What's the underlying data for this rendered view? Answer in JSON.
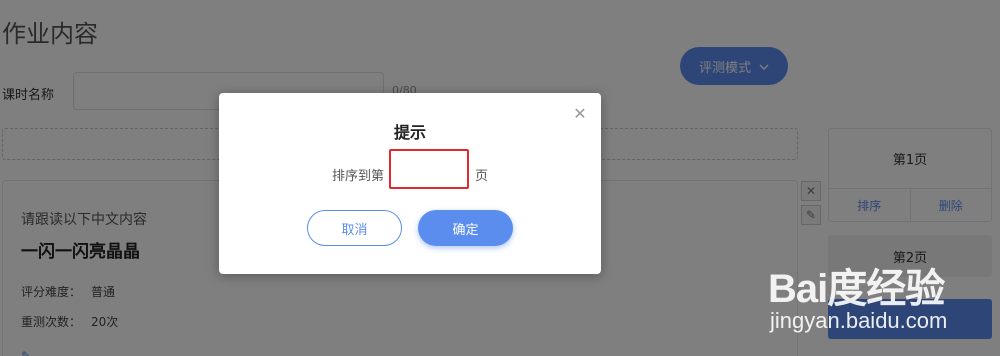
{
  "page": {
    "title": "作业内容",
    "mode_button": "评测模式",
    "lesson_label": "课时名称",
    "lesson_counter": "0/80",
    "card": {
      "prompt": "请跟读以下中文内容",
      "heading": "一闪一闪亮晶晶",
      "difficulty_label": "评分难度：",
      "difficulty_value": "普通",
      "retry_label": "重测次数：",
      "retry_value": "20次"
    },
    "pages": [
      {
        "title": "第1页",
        "sort": "排序",
        "delete": "删除"
      },
      {
        "title": "第2页"
      }
    ]
  },
  "dialog": {
    "title": "提示",
    "sort_prefix": "排序到第",
    "sort_suffix": "页",
    "sort_value": "",
    "cancel": "取消",
    "confirm": "确定",
    "close_icon": "close-icon"
  },
  "watermark": {
    "logo": "Bai度经验",
    "url": "jingyan.baidu.com"
  },
  "colors": {
    "accent": "#5b8def",
    "highlight": "#e0282e"
  }
}
